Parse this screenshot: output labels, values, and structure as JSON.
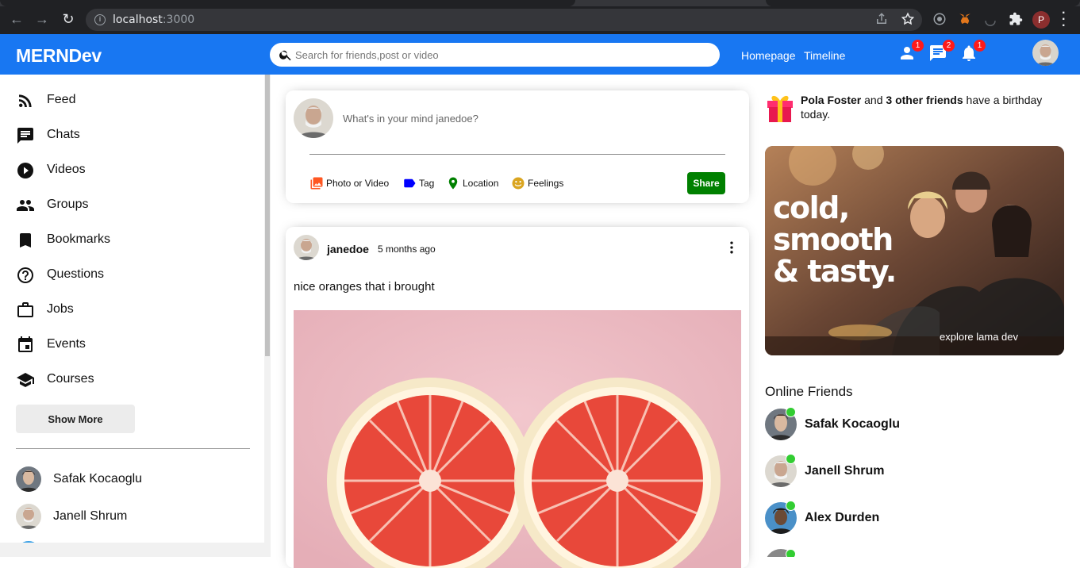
{
  "browser": {
    "url_host": "localhost",
    "url_port": ":3000",
    "profile_initial": "P"
  },
  "topbar": {
    "logo": "MERNDev",
    "search_placeholder": "Search for friends,post or video",
    "links": [
      "Homepage",
      "Timeline"
    ],
    "badges": {
      "person": "1",
      "chat": "2",
      "notifications": "1"
    },
    "accent_color": "#1877f2"
  },
  "sidebar": {
    "items": [
      {
        "label": "Feed",
        "icon": "rss-feed-icon"
      },
      {
        "label": "Chats",
        "icon": "chat-icon"
      },
      {
        "label": "Videos",
        "icon": "play-circle-icon"
      },
      {
        "label": "Groups",
        "icon": "group-icon"
      },
      {
        "label": "Bookmarks",
        "icon": "bookmark-icon"
      },
      {
        "label": "Questions",
        "icon": "help-outline-icon"
      },
      {
        "label": "Jobs",
        "icon": "work-outline-icon"
      },
      {
        "label": "Events",
        "icon": "event-icon"
      },
      {
        "label": "Courses",
        "icon": "school-icon"
      }
    ],
    "show_more": "Show More",
    "friends": [
      "Safak Kocaoglu",
      "Janell Shrum"
    ]
  },
  "share": {
    "placeholder": "What's in your mind janedoe?",
    "options": [
      "Photo or Video",
      "Tag",
      "Location",
      "Feelings"
    ],
    "button": "Share",
    "button_color": "#008000"
  },
  "post": {
    "username": "janedoe",
    "date": "5 months ago",
    "text": "nice oranges that i brought"
  },
  "rightbar": {
    "birthday_name": "Pola Foster",
    "birthday_and": " and ",
    "birthday_others": "3 other friends",
    "birthday_rest": " have a birthday today.",
    "ad_headline_1": "cold,",
    "ad_headline_2": "smooth",
    "ad_headline_3": "& tasty.",
    "ad_sub": "explore lama dev",
    "online_title": "Online Friends",
    "online_friends": [
      "Safak Kocaoglu",
      "Janell Shrum",
      "Alex Durden"
    ],
    "online_color": "#32cd32"
  }
}
